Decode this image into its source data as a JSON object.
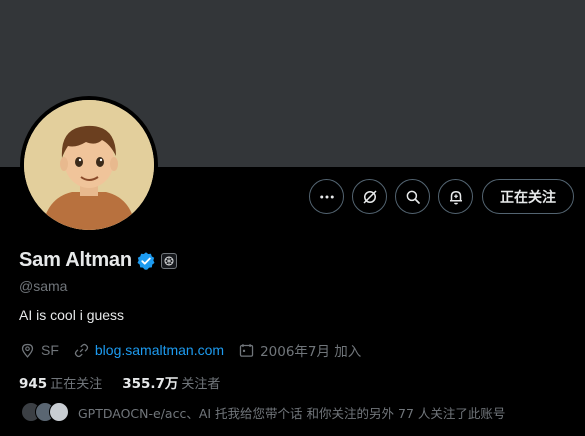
{
  "profile": {
    "name": "Sam Altman",
    "handle": "@sama",
    "bio": "AI is cool i guess",
    "location": "SF",
    "website": "blog.samaltman.com",
    "joined": "2006年7月 加入"
  },
  "actions": {
    "follow_label": "正在关注"
  },
  "stats": {
    "following_count": "945",
    "following_label": "正在关注",
    "followers_count": "355.7万",
    "followers_label": "关注者"
  },
  "followers_you_know": {
    "text": "GPTDAOCN-e/acc、AI 托我给您带个话 和你关注的另外 77 人关注了此账号"
  },
  "icons": {
    "more": "more-horizontal-icon",
    "grok": "grok-icon",
    "search": "search-icon",
    "notify": "bell-plus-icon",
    "verified": "verified-badge-icon",
    "affiliation": "openai-logo-icon",
    "location": "location-pin-icon",
    "link": "link-icon",
    "calendar": "calendar-icon"
  },
  "colors": {
    "background": "#000000",
    "banner": "#333639",
    "accent": "#1d9bf0",
    "text_primary": "#e7e9ea",
    "text_secondary": "#71767b"
  }
}
